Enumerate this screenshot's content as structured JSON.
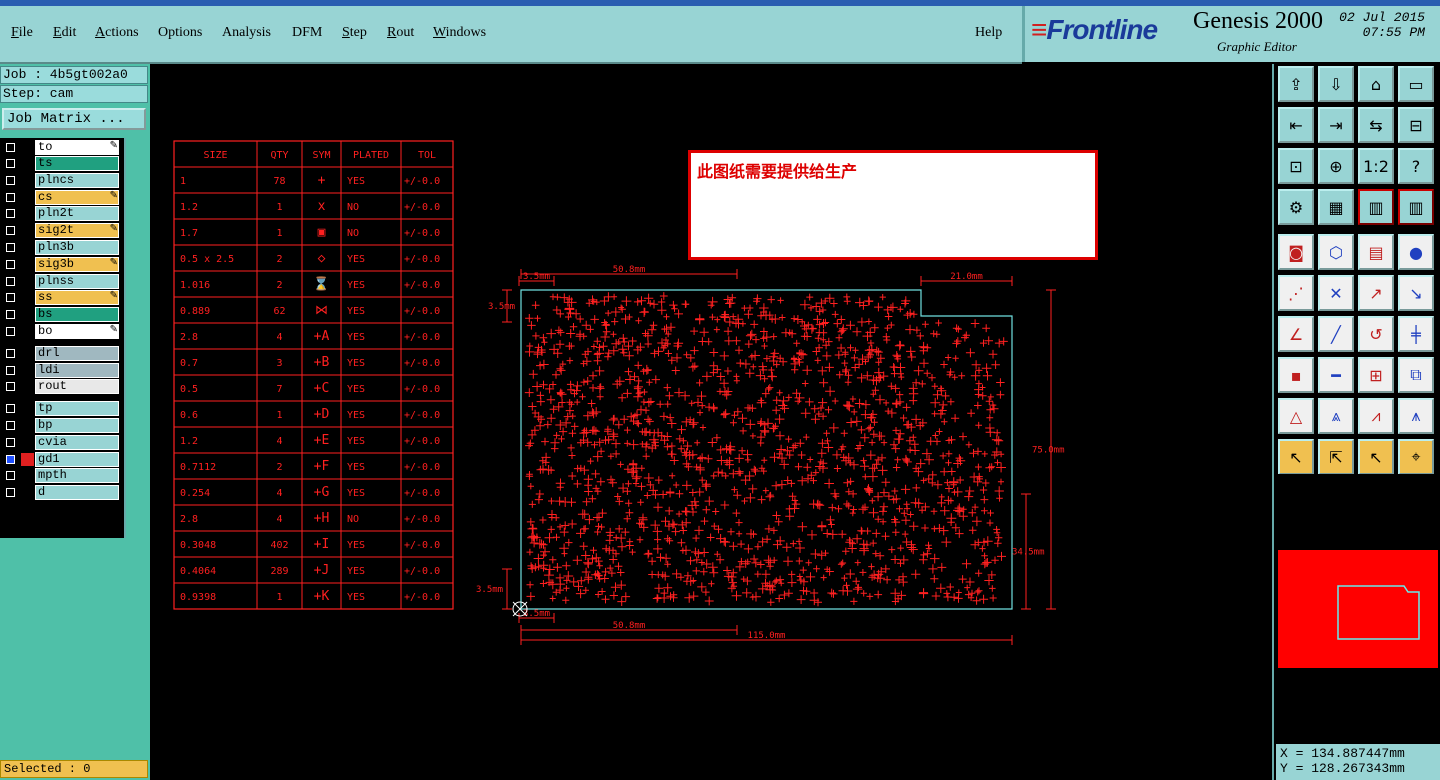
{
  "menubar": {
    "items": [
      "File",
      "Edit",
      "Actions",
      "Options",
      "Analysis",
      "DFM",
      "Step",
      "Rout",
      "Windows"
    ],
    "help": "Help"
  },
  "brand": {
    "logo": "Frontline",
    "product": "Genesis 2000",
    "subtitle": "Graphic Editor",
    "date": "02 Jul 2015",
    "time": "07:55 PM"
  },
  "left": {
    "job": "Job : 4b5gt002a0",
    "step": "Step: cam",
    "job_matrix": "Job Matrix ...",
    "selected": "Selected : 0",
    "layers": [
      {
        "name": "to",
        "color": "#ffffff",
        "swatch": "#000000",
        "edit": true
      },
      {
        "name": "ts",
        "color": "#20a080",
        "swatch": "#000000",
        "edit": false
      },
      {
        "name": "plncs",
        "color": "#98d4d4",
        "swatch": "#000000",
        "edit": false
      },
      {
        "name": "cs",
        "color": "#f0c050",
        "swatch": "#000000",
        "edit": true
      },
      {
        "name": "pln2t",
        "color": "#98d4d4",
        "swatch": "#000000",
        "edit": false
      },
      {
        "name": "sig2t",
        "color": "#f0c050",
        "swatch": "#000000",
        "edit": true
      },
      {
        "name": "pln3b",
        "color": "#98d4d4",
        "swatch": "#000000",
        "edit": false
      },
      {
        "name": "sig3b",
        "color": "#f0c050",
        "swatch": "#000000",
        "edit": true
      },
      {
        "name": "plnss",
        "color": "#98d4d4",
        "swatch": "#000000",
        "edit": false
      },
      {
        "name": "ss",
        "color": "#f0c050",
        "swatch": "#000000",
        "edit": true
      },
      {
        "name": "bs",
        "color": "#20a080",
        "swatch": "#000000",
        "edit": false
      },
      {
        "name": "bo",
        "color": "#ffffff",
        "swatch": "#000000",
        "edit": true
      },
      {
        "name": "drl",
        "color": "#a0b8c0",
        "swatch": "#000000",
        "edit": false
      },
      {
        "name": "ldi",
        "color": "#a0b8c0",
        "swatch": "#000000",
        "edit": false
      },
      {
        "name": "rout",
        "color": "#e8e8e8",
        "swatch": "#000000",
        "edit": false
      },
      {
        "name": "tp",
        "color": "#98d4d4",
        "swatch": "#000000",
        "edit": false
      },
      {
        "name": "bp",
        "color": "#98d4d4",
        "swatch": "#000000",
        "edit": false
      },
      {
        "name": "cvia",
        "color": "#98d4d4",
        "swatch": "#000000",
        "edit": false
      },
      {
        "name": "gd1",
        "color": "#98d4d4",
        "swatch": "#e02020",
        "edit": false,
        "active": true
      },
      {
        "name": "mpth",
        "color": "#98d4d4",
        "swatch": "#000000",
        "edit": false
      },
      {
        "name": "d",
        "color": "#98d4d4",
        "swatch": "#000000",
        "edit": false
      }
    ]
  },
  "note": "此图纸需要提供给生产",
  "drill_table": {
    "headers": [
      "SIZE",
      "QTY",
      "SYM",
      "PLATED",
      "TOL"
    ],
    "rows": [
      [
        "1",
        "78",
        "+",
        "YES",
        "+/-0.0"
      ],
      [
        "1.2",
        "1",
        "x",
        "NO",
        "+/-0.0"
      ],
      [
        "1.7",
        "1",
        "▣",
        "NO",
        "+/-0.0"
      ],
      [
        "0.5 x 2.5",
        "2",
        "◇",
        "YES",
        "+/-0.0"
      ],
      [
        "1.016",
        "2",
        "⌛",
        "YES",
        "+/-0.0"
      ],
      [
        "0.889",
        "62",
        "⋈",
        "YES",
        "+/-0.0"
      ],
      [
        "2.8",
        "4",
        "+A",
        "YES",
        "+/-0.0"
      ],
      [
        "0.7",
        "3",
        "+B",
        "YES",
        "+/-0.0"
      ],
      [
        "0.5",
        "7",
        "+C",
        "YES",
        "+/-0.0"
      ],
      [
        "0.6",
        "1",
        "+D",
        "YES",
        "+/-0.0"
      ],
      [
        "1.2",
        "4",
        "+E",
        "YES",
        "+/-0.0"
      ],
      [
        "0.7112",
        "2",
        "+F",
        "YES",
        "+/-0.0"
      ],
      [
        "0.254",
        "4",
        "+G",
        "YES",
        "+/-0.0"
      ],
      [
        "2.8",
        "4",
        "+H",
        "NO",
        "+/-0.0"
      ],
      [
        "0.3048",
        "402",
        "+I",
        "YES",
        "+/-0.0"
      ],
      [
        "0.4064",
        "289",
        "+J",
        "YES",
        "+/-0.0"
      ],
      [
        "0.9398",
        "1",
        "+K",
        "YES",
        "+/-0.0"
      ]
    ]
  },
  "dims": {
    "top_left": "3.5mm",
    "top_width": "50.8mm",
    "top_right": "21.0mm",
    "left_top": "3.5mm",
    "right_height": "75.0mm",
    "right_lower": "34.5mm",
    "left_bottom": "3.5mm",
    "bottom_left": "3.5mm",
    "bottom_width": "50.8mm",
    "total_width": "115.0mm"
  },
  "coords": {
    "x": "X = 134.887447mm",
    "y": "Y = 128.267343mm"
  },
  "toolbar": {
    "icons": [
      "save-up-icon",
      "save-down-icon",
      "home-icon",
      "window-icon",
      "import-icon",
      "export-icon",
      "swap-icon",
      "grid-icon",
      "zoom-fit-icon",
      "zoom-in-icon",
      "ratio-icon",
      "help-icon",
      "tools-icon",
      "grid-view-icon",
      "layer-icon-a",
      "layer-icon-b",
      "pad-icon",
      "shape-icon",
      "ruler-icon",
      "circle-icon",
      "connect-icon",
      "cross-icon",
      "line-to-icon",
      "point-icon",
      "angle-icon",
      "line-icon",
      "arc-icon",
      "ff-icon",
      "pad-move-icon",
      "minus-icon",
      "box-icon",
      "multi-icon",
      "tri-a-icon",
      "tri-b-icon",
      "tri-c-icon",
      "tri-d-icon",
      "select-icon",
      "select-box-icon",
      "select-lasso-icon",
      "select-net-icon"
    ],
    "ratio_label": "1:2",
    "help_label": "?"
  }
}
